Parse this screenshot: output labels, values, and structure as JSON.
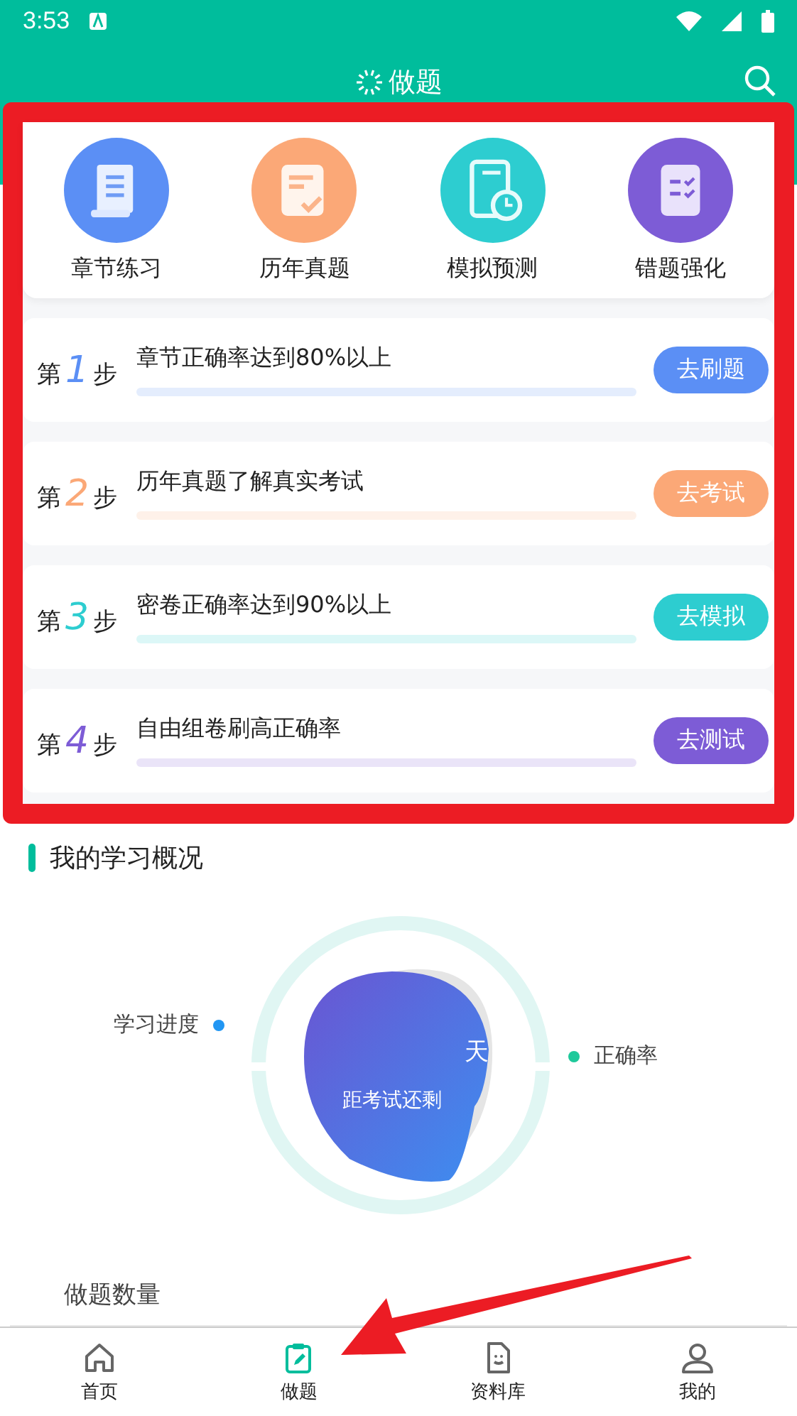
{
  "status_bar": {
    "time": "3:53"
  },
  "header": {
    "title": "做题"
  },
  "quick_entries": [
    {
      "label": "章节练习",
      "color": "#5b8ff5",
      "kind": "scroll"
    },
    {
      "label": "历年真题",
      "color": "#fba877",
      "kind": "paper"
    },
    {
      "label": "模拟预测",
      "color": "#2dcdd0",
      "kind": "clock"
    },
    {
      "label": "错题强化",
      "color": "#7d5cd6",
      "kind": "clipboard"
    }
  ],
  "steps": [
    {
      "prefix": "第",
      "number": "1",
      "suffix": "步",
      "text": "章节正确率达到80%以上",
      "button": "去刷题",
      "color": "#5b8ff5"
    },
    {
      "prefix": "第",
      "number": "2",
      "suffix": "步",
      "text": "历年真题了解真实考试",
      "button": "去考试",
      "color": "#fba877"
    },
    {
      "prefix": "第",
      "number": "3",
      "suffix": "步",
      "text": "密卷正确率达到90%以上",
      "button": "去模拟",
      "color": "#2dcdd0"
    },
    {
      "prefix": "第",
      "number": "4",
      "suffix": "步",
      "text": "自由组卷刷高正确率",
      "button": "去测试",
      "color": "#7d5cd6"
    }
  ],
  "overview": {
    "title": "我的学习概况",
    "days_unit": "天",
    "countdown_label": "距考试还剩",
    "legend": [
      {
        "label": "学习进度",
        "color": "#2196f3"
      },
      {
        "label": "正确率",
        "color": "#1ec99b"
      }
    ],
    "question_count_label": "做题数量"
  },
  "bottom_nav": [
    {
      "label": "首页",
      "kind": "home",
      "selected": false
    },
    {
      "label": "做题",
      "kind": "exercise",
      "selected": true
    },
    {
      "label": "资料库",
      "kind": "library",
      "selected": false
    },
    {
      "label": "我的",
      "kind": "profile",
      "selected": false
    }
  ]
}
